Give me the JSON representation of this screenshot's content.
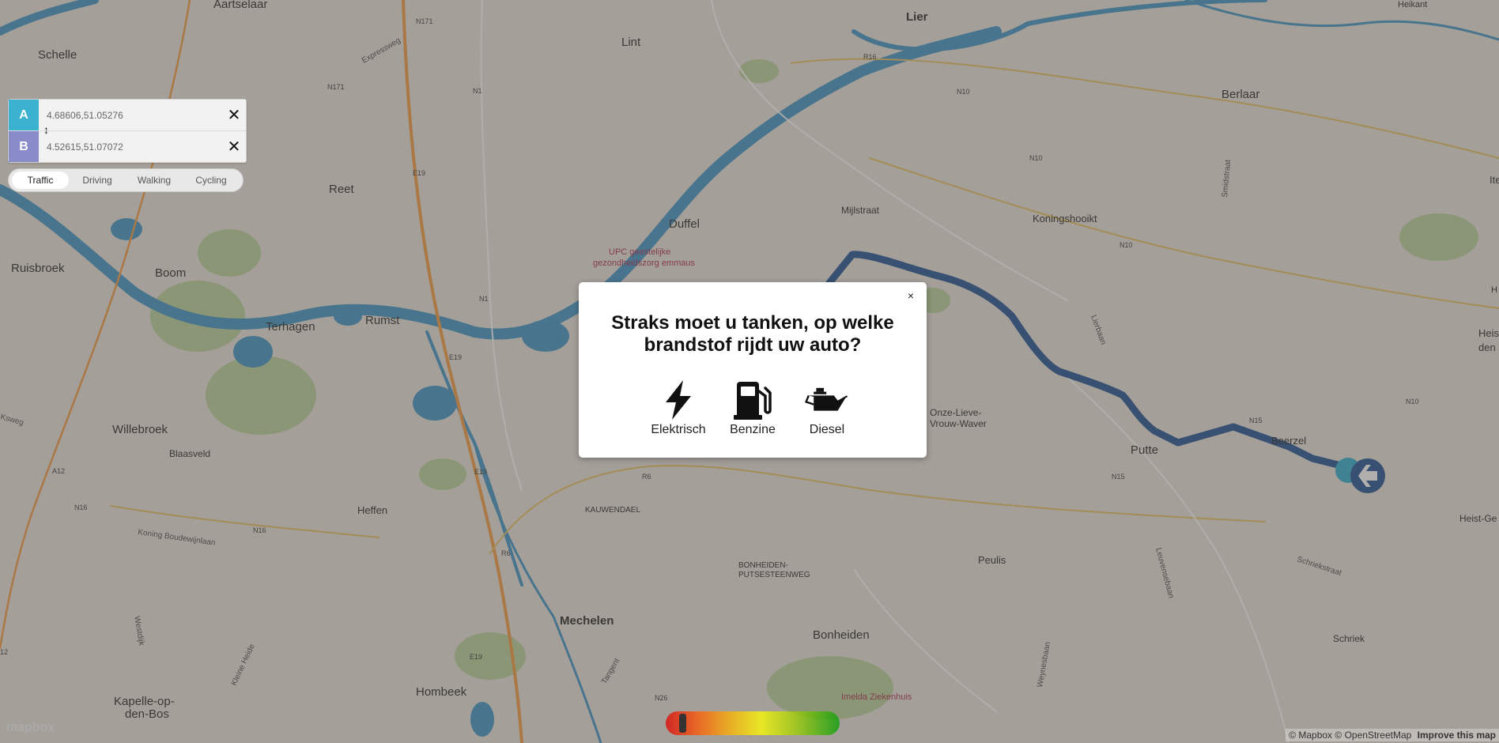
{
  "directions": {
    "origin": {
      "badge": "A",
      "value": "4.68606,51.05276",
      "clear_icon": "close-icon"
    },
    "destination": {
      "badge": "B",
      "value": "4.52615,51.07072",
      "clear_icon": "close-icon"
    },
    "swap_icon": "swap-vertical-icon",
    "profiles": [
      "Traffic",
      "Driving",
      "Walking",
      "Cycling"
    ],
    "active_profile": "Traffic"
  },
  "modal": {
    "close_label": "×",
    "title": "Straks moet u tanken, op welke brandstof rijdt uw auto?",
    "options": [
      {
        "label": "Elektrisch",
        "icon": "lightning-icon"
      },
      {
        "label": "Benzine",
        "icon": "fuel-pump-icon"
      },
      {
        "label": "Diesel",
        "icon": "oil-can-icon"
      }
    ]
  },
  "fuel_gauge": {
    "level": 0.08
  },
  "map": {
    "places": [
      "Aartselaar",
      "Schelle",
      "Lint",
      "Lier",
      "Heikant",
      "Berlaar",
      "Reet",
      "Duffel",
      "Mijlstraat",
      "Koningshooikt",
      "Ruisbroek",
      "Boom",
      "Terhagen",
      "Rumst",
      "Willebroek",
      "Blaasveld",
      "Onze-Lieve-Vrouw-Waver",
      "Putte",
      "Beerzel",
      "Heffen",
      "KAUWENDAEL",
      "Peulis",
      "BONHEIDEN-PUTSESTEENWEG",
      "Mechelen",
      "Bonheiden",
      "Schriek",
      "Hombeek",
      "Kapelle-op-den-Bos",
      "Heist-Ge",
      "Ite",
      "Heis den",
      "H"
    ],
    "pois": [
      "UPC geestelijke gezondheidszorg emmaus",
      "Imelda Ziekenhuis"
    ],
    "roads": [
      "N171",
      "N1",
      "E19",
      "R16",
      "N10",
      "N15",
      "A12",
      "N16",
      "R6",
      "N26",
      "Expressweg",
      "Koning Boudewijnlaan",
      "Smidstraat",
      "Lierbaan",
      "Leuvensebaan",
      "Weynesbaan",
      "Schriekstraat",
      "Tangent",
      "Kleine Heide",
      "Westdijk",
      "Ksweg"
    ],
    "colors": {
      "route": "#2f5d9a",
      "water": "#3a8bbf",
      "park": "#a9c98a",
      "land": "#e8e4dc"
    }
  },
  "attribution": {
    "mapbox": "© Mapbox",
    "osm": "© OpenStreetMap",
    "improve": "Improve this map"
  },
  "logo": "mapbox"
}
